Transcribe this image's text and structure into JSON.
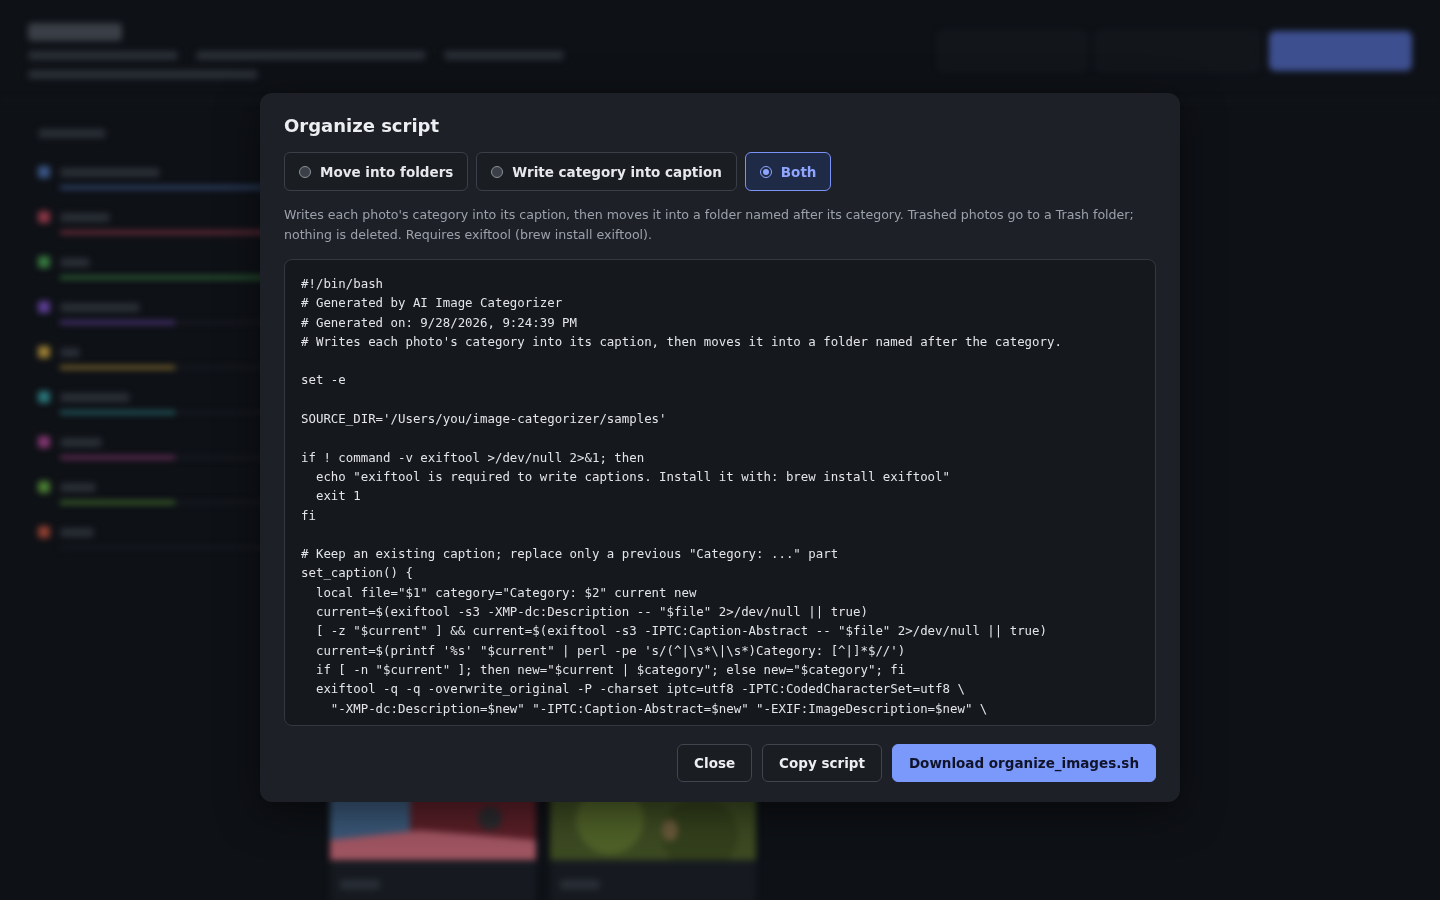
{
  "dialog": {
    "title": "Organize script",
    "modes": [
      {
        "label": "Move into folders",
        "selected": false
      },
      {
        "label": "Write category into caption",
        "selected": false
      },
      {
        "label": "Both",
        "selected": true
      }
    ],
    "description": "Writes each photo's category into its caption, then moves it into a folder named after its category. Trashed photos go to a Trash folder; nothing is deleted. Requires exiftool (brew install exiftool).",
    "script": "#!/bin/bash\n# Generated by AI Image Categorizer\n# Generated on: 9/28/2026, 9:24:39 PM\n# Writes each photo's category into its caption, then moves it into a folder named after the category.\n\nset -e\n\nSOURCE_DIR='/Users/you/image-categorizer/samples'\n\nif ! command -v exiftool >/dev/null 2>&1; then\n  echo \"exiftool is required to write captions. Install it with: brew install exiftool\"\n  exit 1\nfi\n\n# Keep an existing caption; replace only a previous \"Category: ...\" part\nset_caption() {\n  local file=\"$1\" category=\"Category: $2\" current new\n  current=$(exiftool -s3 -XMP-dc:Description -- \"$file\" 2>/dev/null || true)\n  [ -z \"$current\" ] && current=$(exiftool -s3 -IPTC:Caption-Abstract -- \"$file\" 2>/dev/null || true)\n  current=$(printf '%s' \"$current\" | perl -pe 's/(^|\\s*\\|\\s*)Category: [^|]*$//')\n  if [ -n \"$current\" ]; then new=\"$current | $category\"; else new=\"$category\"; fi\n  exiftool -q -q -overwrite_original -P -charset iptc=utf8 -IPTC:CodedCharacterSet=utf8 \\\n    \"-XMP-dc:Description=$new\" \"-IPTC:Caption-Abstract=$new\" \"-EXIF:ImageDescription=$new\" \\",
    "buttons": [
      {
        "label": "Close",
        "primary": false
      },
      {
        "label": "Copy script",
        "primary": false
      },
      {
        "label": "Download organize_images.sh",
        "primary": true
      }
    ]
  }
}
